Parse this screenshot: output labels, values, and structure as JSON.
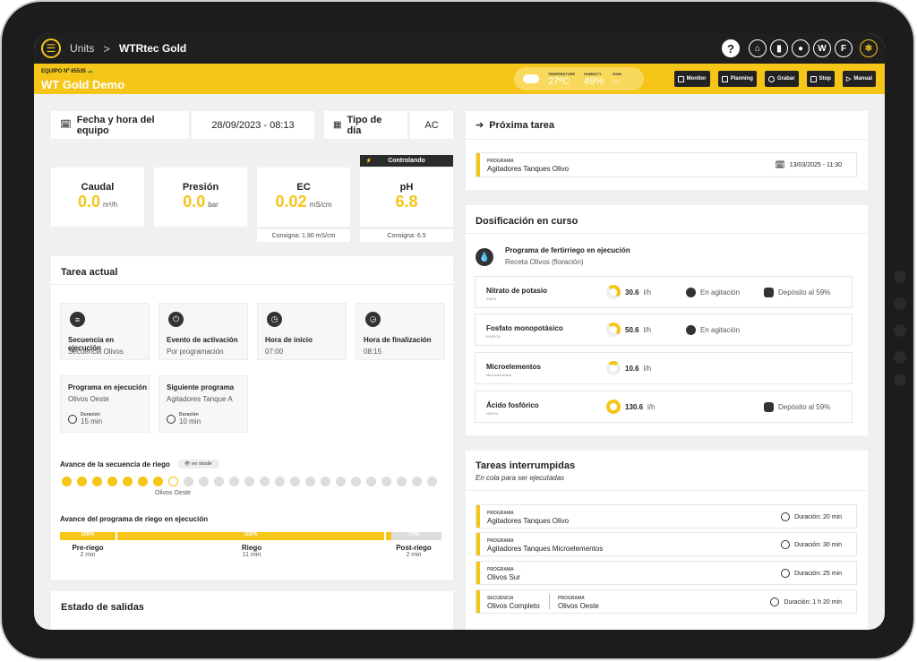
{
  "topbar": {
    "units_label": "Units",
    "separator": ">",
    "current": "WTRtec Gold",
    "icons": [
      "help-icon",
      "home-icon",
      "chart-icon",
      "location-icon",
      "W",
      "F",
      "gear-icon"
    ]
  },
  "header": {
    "equipo_no": "EQUIPO Nº 65535",
    "equipo_name": "WT Gold Demo",
    "weather": {
      "temp_label": "TEMPERATURE",
      "temp": "27ºC",
      "hum_label": "HUMIDITY",
      "hum": "49%",
      "rain_label": "RAIN",
      "rain": "--"
    },
    "buttons": [
      "Monitor",
      "Planning",
      "Grabar",
      "Stop",
      "Manual"
    ]
  },
  "fecha": {
    "label": "Fecha y hora del equipo",
    "value": "28/09/2023 - 08:13"
  },
  "tipo_dia": {
    "label": "Tipo de día",
    "value": "AC"
  },
  "metrics": {
    "caudal": {
      "label": "Caudal",
      "value": "0.0",
      "unit": "m³/h"
    },
    "presion": {
      "label": "Presión",
      "value": "0.0",
      "unit": "bar"
    },
    "ec": {
      "label": "EC",
      "value": "0.02",
      "unit": "mS/cm",
      "consigna": "Consigna: 1.90 mS/cm"
    },
    "ph": {
      "label": "pH",
      "value": "6.8",
      "badge": "Controlando",
      "consigna": "Consigna: 6.5"
    }
  },
  "tarea_actual": {
    "title": "Tarea actual",
    "tiles": [
      {
        "title": "Secuencia en ejecución",
        "sub": "Secuencia Olivos"
      },
      {
        "title": "Evento de activación",
        "sub": "Por programación"
      },
      {
        "title": "Hora de inicio",
        "sub": "07:00"
      },
      {
        "title": "Hora de finalización",
        "sub": "08:15"
      }
    ],
    "programa": {
      "title": "Programa en ejecución",
      "sub": "Olivos Oeste",
      "dur_label": "Duración",
      "dur": "15 min"
    },
    "siguiente": {
      "title": "Siguiente programa",
      "sub": "Agitadores Tanque A",
      "dur_label": "Duración",
      "dur": "10 min"
    },
    "avance_seq": {
      "label": "Avance de la secuencia de riego",
      "detail": "ver detalle",
      "done": 7,
      "total": 25,
      "current_label": "Olivos Oeste"
    },
    "avance_prog": {
      "label": "Avance del programa de riego en ejecución",
      "phases": [
        {
          "name": "Pre-riego",
          "dur": "2 min",
          "pct": "100%"
        },
        {
          "name": "Riego",
          "dur": "11 min",
          "pct": "100%"
        },
        {
          "name": "Post-riego",
          "dur": "2 min",
          "pct": "10%"
        }
      ]
    }
  },
  "estado_salidas": {
    "title": "Estado de salidas"
  },
  "proxima": {
    "title": "Próxima tarea",
    "prog_label": "PROGRAMA",
    "prog": "Agitadores Tanques Olivo",
    "date": "13/03/2025 - 11:30"
  },
  "dosificacion": {
    "title": "Dosificación en curso",
    "prog_title": "Programa de fertirriego en ejecución",
    "prog_sub": "Receta Olivos (floración)",
    "rows": [
      {
        "name": "Nitrato de potasio",
        "formula": "KNO3",
        "rate": "30.6",
        "unit": "l/h",
        "agit": "En agitación",
        "dep": "Depósito al 59%"
      },
      {
        "name": "Fosfato monopotásico",
        "formula": "KH2PO4",
        "rate": "50.6",
        "unit": "l/h",
        "agit": "En agitación",
        "dep": ""
      },
      {
        "name": "Microelementos",
        "formula": "Microelementos",
        "rate": "10.6",
        "unit": "l/h",
        "agit": "",
        "dep": ""
      },
      {
        "name": "Ácido fosfórico",
        "formula": "H3PO4",
        "rate": "130.6",
        "unit": "l/h",
        "agit": "",
        "dep": "Depósito al 59%"
      }
    ]
  },
  "interrumpidas": {
    "title": "Tareas interrumpidas",
    "subtitle": "En cola para ser ejecutadas",
    "rows": [
      {
        "label": "PROGRAMA",
        "name": "Agitadores Tanques Olivo",
        "dur": "Duración: 20 min"
      },
      {
        "label": "PROGRAMA",
        "name": "Agitadores Tanques Microelementos",
        "dur": "Duración: 30 min"
      },
      {
        "label": "PROGRAMA",
        "name": "Olivos Sur",
        "dur": "Duración: 25 min"
      }
    ],
    "last": {
      "seq_label": "SECUENCIA",
      "seq": "Olivos Completo",
      "prog_label": "PROGRAMA",
      "prog": "Olivos Oeste",
      "dur": "Duración:  1 h 20 min"
    }
  }
}
